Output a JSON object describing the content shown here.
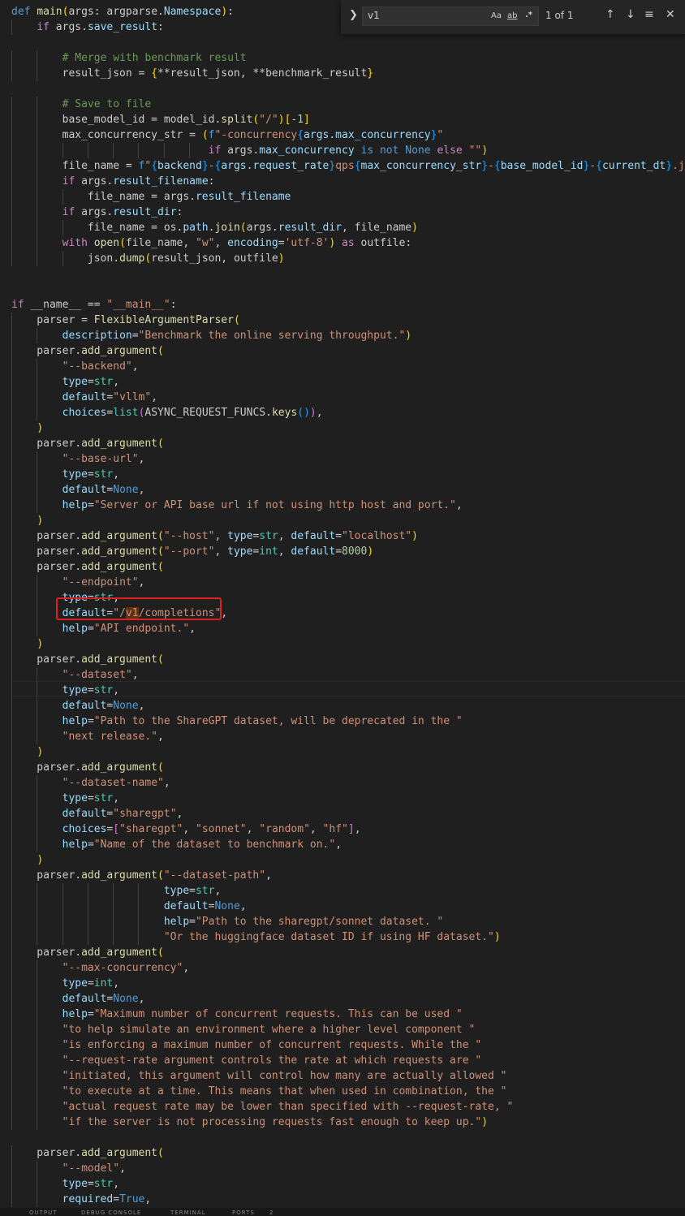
{
  "find": {
    "query": "v1",
    "match_case_label": "Aa",
    "whole_word_label": "ab",
    "regex_label": ".*",
    "match_count": "1 of 1",
    "toggle_icon": "chevron-right-icon",
    "prev_icon": "arrow-up-icon",
    "next_icon": "arrow-down-icon",
    "selection_icon": "find-in-selection-icon",
    "close_icon": "close-icon"
  },
  "status_bar": {
    "tabs": [
      "OUTPUT",
      "DEBUG CONSOLE",
      "TERMINAL",
      "PORTS"
    ],
    "ports_badge": "2"
  },
  "lines": [
    "def main(args: argparse.Namespace):",
    "    if args.save_result:",
    "",
    "        # Merge with benchmark result",
    "        result_json = {**result_json, **benchmark_result}",
    "",
    "        # Save to file",
    "        base_model_id = model_id.split(\"/\")[-1]",
    "        max_concurrency_str = (f\"-concurrency{args.max_concurrency}\"",
    "                               if args.max_concurrency is not None else \"\")",
    "        file_name = f\"{backend}-{args.request_rate}qps{max_concurrency_str}-{base_model_id}-{current_dt}.json\"",
    "        if args.result_filename:",
    "            file_name = args.result_filename",
    "        if args.result_dir:",
    "            file_name = os.path.join(args.result_dir, file_name)",
    "        with open(file_name, \"w\", encoding='utf-8') as outfile:",
    "            json.dump(result_json, outfile)",
    "",
    "",
    "if __name__ == \"__main__\":",
    "    parser = FlexibleArgumentParser(",
    "        description=\"Benchmark the online serving throughput.\")",
    "    parser.add_argument(",
    "        \"--backend\",",
    "        type=str,",
    "        default=\"vllm\",",
    "        choices=list(ASYNC_REQUEST_FUNCS.keys()),",
    "    )",
    "    parser.add_argument(",
    "        \"--base-url\",",
    "        type=str,",
    "        default=None,",
    "        help=\"Server or API base url if not using http host and port.\",",
    "    )",
    "    parser.add_argument(\"--host\", type=str, default=\"localhost\")",
    "    parser.add_argument(\"--port\", type=int, default=8000)",
    "    parser.add_argument(",
    "        \"--endpoint\",",
    "        type=str,",
    "        default=\"/v1/completions\",",
    "        help=\"API endpoint.\",",
    "    )",
    "    parser.add_argument(",
    "        \"--dataset\",",
    "        type=str,",
    "        default=None,",
    "        help=\"Path to the ShareGPT dataset, will be deprecated in the \"",
    "        \"next release.\",",
    "    )",
    "    parser.add_argument(",
    "        \"--dataset-name\",",
    "        type=str,",
    "        default=\"sharegpt\",",
    "        choices=[\"sharegpt\", \"sonnet\", \"random\", \"hf\"],",
    "        help=\"Name of the dataset to benchmark on.\",",
    "    )",
    "    parser.add_argument(\"--dataset-path\",",
    "                        type=str,",
    "                        default=None,",
    "                        help=\"Path to the sharegpt/sonnet dataset. \"",
    "                        \"Or the huggingface dataset ID if using HF dataset.\")",
    "    parser.add_argument(",
    "        \"--max-concurrency\",",
    "        type=int,",
    "        default=None,",
    "        help=\"Maximum number of concurrent requests. This can be used \"",
    "        \"to help simulate an environment where a higher level component \"",
    "        \"is enforcing a maximum number of concurrent requests. While the \"",
    "        \"--request-rate argument controls the rate at which requests are \"",
    "        \"initiated, this argument will control how many are actually allowed \"",
    "        \"to execute at a time. This means that when used in combination, the \"",
    "        \"actual request rate may be lower than specified with --request-rate, \"",
    "        \"if the server is not processing requests fast enough to keep up.\")",
    "",
    "    parser.add_argument(",
    "        \"--model\",",
    "        type=str,",
    "        required=True,"
  ]
}
